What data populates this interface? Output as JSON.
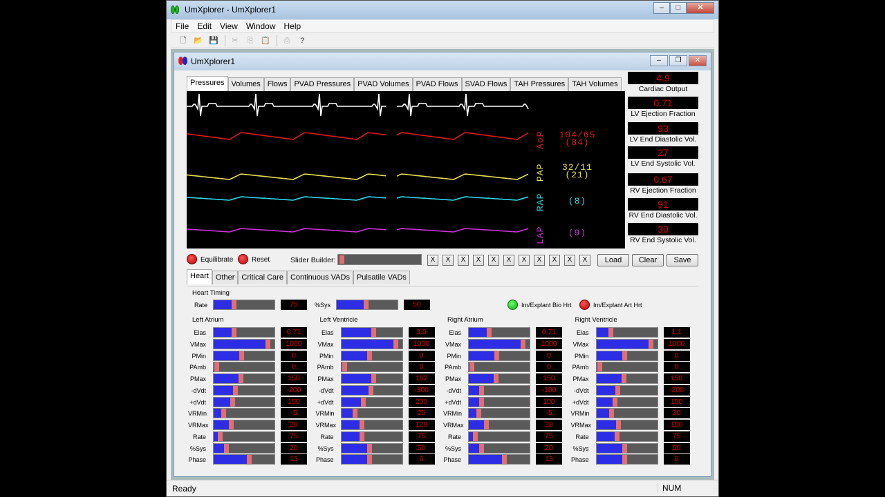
{
  "window": {
    "title": "UmXplorer - UmXplorer1"
  },
  "menu": [
    "File",
    "Edit",
    "View",
    "Window",
    "Help"
  ],
  "toolbar_icons": [
    "new-icon",
    "open-icon",
    "save-icon",
    "cut-icon",
    "copy-icon",
    "paste-icon",
    "print-icon",
    "help-icon"
  ],
  "child": {
    "title": "UmXplorer1"
  },
  "top_tabs": [
    "Pressures",
    "Volumes",
    "Flows",
    "PVAD Pressures",
    "PVAD Volumes",
    "PVAD Flows",
    "SVAD Flows",
    "TAH Pressures",
    "TAH Volumes"
  ],
  "monitor": {
    "traces": [
      {
        "label": "AoP",
        "value": "104/65\n(84)",
        "color": "#e01818"
      },
      {
        "label": "PAP",
        "value": "32/11\n(21)",
        "color": "#e8e050"
      },
      {
        "label": "RAP",
        "value": "(8)",
        "color": "#30d8e8"
      },
      {
        "label": "LAP",
        "value": "(9)",
        "color": "#d030d8"
      }
    ]
  },
  "readouts": [
    {
      "value": "4.9",
      "label": "Cardiac Output"
    },
    {
      "value": "0.71",
      "label": "LV Ejection Fraction"
    },
    {
      "value": "93",
      "label": "LV End Diastolic Vol."
    },
    {
      "value": "27",
      "label": "LV End Systolic Vol."
    },
    {
      "value": "0.67",
      "label": "RV Ejection Fraction"
    },
    {
      "value": "91",
      "label": "RV End Diastolic Vol."
    },
    {
      "value": "30",
      "label": "RV End Systolic Vol."
    }
  ],
  "controls": {
    "equilibrate": "Equilibrate",
    "reset": "Reset",
    "slider_builder": "Slider Builder:",
    "x_label": "X",
    "load": "Load",
    "clear": "Clear",
    "save": "Save"
  },
  "bottom_tabs": [
    "Heart",
    "Other",
    "Critical Care",
    "Continuous VADs",
    "Pulsatile VADs"
  ],
  "heart_timing": {
    "title": "Heart Timing",
    "rate": {
      "label": "Rate",
      "value": "75",
      "fill": 0.35
    },
    "sys": {
      "label": "%Sys",
      "value": "50",
      "fill": 0.5
    },
    "bio": "Im/Explant Bio Hrt",
    "art": "Im/Explant Art Hrt"
  },
  "param_labels": [
    "Elas",
    "VMax",
    "PMin",
    "PAmb",
    "PMax",
    "-dVdt",
    "+dVdt",
    "VRMin",
    "VRMax",
    "Rate",
    "%Sys",
    "Phase"
  ],
  "groups": [
    {
      "title": "Left Atrium",
      "values": [
        "0.71",
        "1000",
        "0",
        "0",
        "150",
        "-200",
        "150",
        "-5",
        "28",
        "75",
        "20",
        "13"
      ],
      "fills": [
        0.35,
        0.92,
        0.48,
        0.06,
        0.47,
        0.37,
        0.32,
        0.18,
        0.3,
        0.12,
        0.22,
        0.6
      ]
    },
    {
      "title": "Left Ventricle",
      "values": [
        "3.0",
        "1000",
        "0",
        "0",
        "182",
        "-300",
        "200",
        "25",
        "128",
        "75",
        "50",
        "0"
      ],
      "fills": [
        0.55,
        0.92,
        0.48,
        0.06,
        0.55,
        0.5,
        0.38,
        0.24,
        0.35,
        0.35,
        0.48,
        0.48
      ]
    },
    {
      "title": "Right Atrium",
      "values": [
        "0.71",
        "1000",
        "0",
        "0",
        "150",
        "-100",
        "100",
        "-5",
        "28",
        "75",
        "20",
        "13"
      ],
      "fills": [
        0.35,
        0.92,
        0.48,
        0.06,
        0.47,
        0.22,
        0.22,
        0.18,
        0.3,
        0.12,
        0.22,
        0.6
      ]
    },
    {
      "title": "Right Ventricle",
      "values": [
        "1.1",
        "1000",
        "0",
        "0",
        "150",
        "-200",
        "150",
        "30",
        "100",
        "75",
        "50",
        "0"
      ],
      "fills": [
        0.25,
        0.92,
        0.48,
        0.06,
        0.47,
        0.37,
        0.32,
        0.26,
        0.38,
        0.35,
        0.48,
        0.48
      ]
    }
  ],
  "status": {
    "left": "Ready",
    "right": "NUM"
  }
}
